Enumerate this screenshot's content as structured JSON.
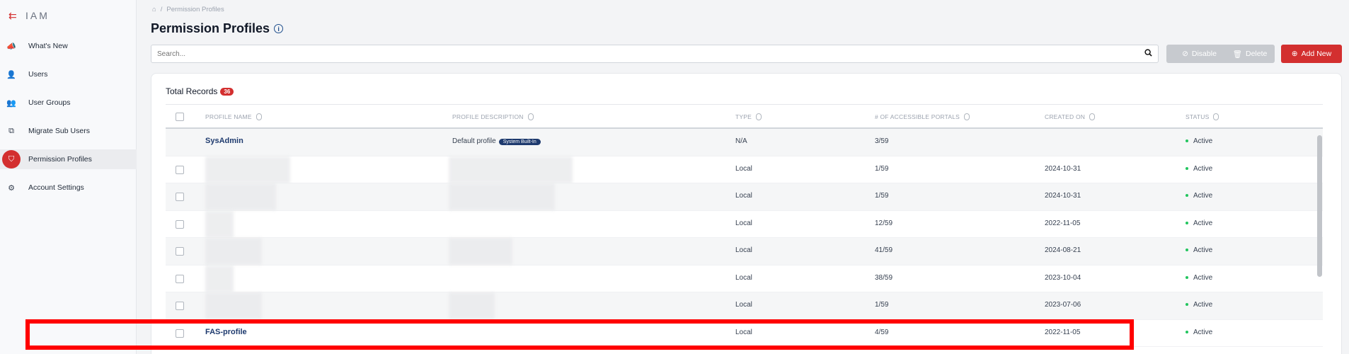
{
  "app": {
    "title": "IAM"
  },
  "sidebar": {
    "items": [
      {
        "label": "What's New",
        "icon": "megaphone-icon",
        "active": false
      },
      {
        "label": "Users",
        "icon": "user-icon",
        "active": false
      },
      {
        "label": "User Groups",
        "icon": "user-group-icon",
        "active": false
      },
      {
        "label": "Migrate Sub Users",
        "icon": "migrate-icon",
        "active": false
      },
      {
        "label": "Permission Profiles",
        "icon": "shield-icon",
        "active": true
      },
      {
        "label": "Account Settings",
        "icon": "gear-icon",
        "active": false
      }
    ]
  },
  "breadcrumb": {
    "separator": "/",
    "current": "Permission Profiles"
  },
  "page": {
    "title": "Permission Profiles"
  },
  "search": {
    "placeholder": "Search..."
  },
  "toolbar": {
    "disable_label": "Disable",
    "delete_label": "Delete",
    "add_label": "Add New"
  },
  "table": {
    "total_label": "Total Records",
    "total_count": "36",
    "columns": [
      "Profile Name",
      "Profile Description",
      "Type",
      "# of Accessible Portals",
      "Created On",
      "Status"
    ],
    "rows": [
      {
        "name": "SysAdmin",
        "description": "Default profile",
        "tag": "System Built-In",
        "type": "N/A",
        "portals": "3/59",
        "created": "",
        "status": "Active"
      },
      {
        "name": "",
        "description": "",
        "tag": "",
        "type": "Local",
        "portals": "1/59",
        "created": "2024-10-31",
        "status": "Active"
      },
      {
        "name": "",
        "description": "",
        "tag": "",
        "type": "Local",
        "portals": "1/59",
        "created": "2024-10-31",
        "status": "Active"
      },
      {
        "name": "",
        "description": "",
        "tag": "",
        "type": "Local",
        "portals": "12/59",
        "created": "2022-11-05",
        "status": "Active"
      },
      {
        "name": "",
        "description": "",
        "tag": "",
        "type": "Local",
        "portals": "41/59",
        "created": "2024-08-21",
        "status": "Active"
      },
      {
        "name": "",
        "description": "",
        "tag": "",
        "type": "Local",
        "portals": "38/59",
        "created": "2023-10-04",
        "status": "Active"
      },
      {
        "name": "",
        "description": "",
        "tag": "",
        "type": "Local",
        "portals": "1/59",
        "created": "2023-07-06",
        "status": "Active"
      },
      {
        "name": "FAS-profile",
        "description": "",
        "tag": "",
        "type": "Local",
        "portals": "4/59",
        "created": "2022-11-05",
        "status": "Active"
      }
    ]
  },
  "colors": {
    "accent": "#d32f2f",
    "link": "#1e3a6e",
    "status_active": "#22c55e",
    "highlight": "#ff0000"
  }
}
